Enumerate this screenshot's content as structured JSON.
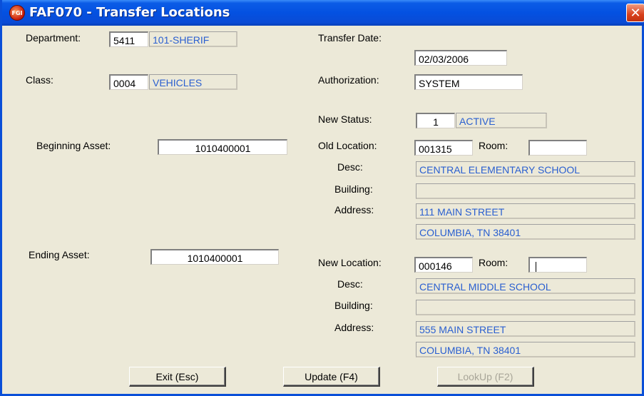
{
  "window": {
    "title": "FAF070 - Transfer Locations",
    "icon_text": "FGI",
    "close_glyph": "✕"
  },
  "department": {
    "label": "Department:",
    "code": "5411",
    "name": "101-SHERIF"
  },
  "class": {
    "label": "Class:",
    "code": "0004",
    "name": "VEHICLES"
  },
  "transfer_date": {
    "label": "Transfer Date:",
    "value": "02/03/2006"
  },
  "authorization": {
    "label": "Authorization:",
    "value": "SYSTEM"
  },
  "new_status": {
    "label": "New Status:",
    "code": "1",
    "name": "ACTIVE"
  },
  "beginning_asset": {
    "label": "Beginning Asset:",
    "value": "1010400001"
  },
  "ending_asset": {
    "label": "Ending Asset:",
    "value": "1010400001"
  },
  "old_location": {
    "label": "Old Location:",
    "code": "001315",
    "room_label": "Room:",
    "room": "",
    "desc_label": "Desc:",
    "desc": "CENTRAL ELEMENTARY SCHOOL",
    "building_label": "Building:",
    "building": "",
    "address_label": "Address:",
    "address1": "111 MAIN STREET",
    "address2": "COLUMBIA, TN 38401"
  },
  "new_location": {
    "label": "New Location:",
    "code": "000146",
    "room_label": "Room:",
    "room": "",
    "desc_label": "Desc:",
    "desc": "CENTRAL MIDDLE SCHOOL",
    "building_label": "Building:",
    "building": "",
    "address_label": "Address:",
    "address1": "555 MAIN STREET",
    "address2": "COLUMBIA, TN 38401"
  },
  "buttons": {
    "exit": "Exit (Esc)",
    "update": "Update (F4)",
    "lookup": "LookUp (F2)"
  },
  "colors": {
    "titlebar": "#0451e1",
    "readonly_text": "#2a5fd0",
    "window_bg": "#ece9d8"
  }
}
